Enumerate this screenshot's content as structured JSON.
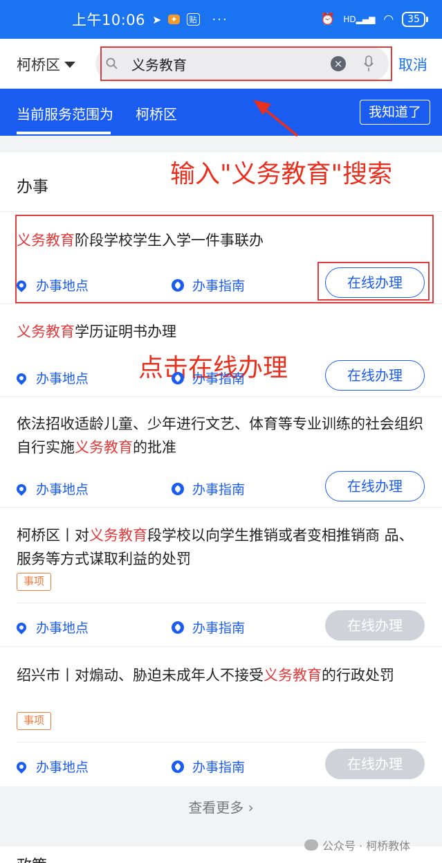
{
  "status_bar": {
    "time": "上午10:06",
    "notif_icons": [
      "navigation-icon",
      "app-icon",
      "paste-icon"
    ],
    "dots": "···",
    "network": "HD",
    "battery": "35"
  },
  "header": {
    "district": "柯桥区",
    "search_value": "义务教育",
    "cancel_label": "取消"
  },
  "notice": {
    "text": "当前服务范围为",
    "district": "柯桥区",
    "ok_label": "我知道了"
  },
  "annotations": {
    "search_hint": "输入\"义务教育\"搜索",
    "click_hint": "点击在线办理"
  },
  "section": {
    "title": "办事"
  },
  "results": [
    {
      "title_parts": [
        "义务教育",
        "阶段学校学生入学一件事联办"
      ],
      "location": "办事地点",
      "guide": "办事指南",
      "action": "在线办理",
      "enabled": true
    },
    {
      "title_parts": [
        "义务教育",
        "学历证明书办理"
      ],
      "location": "办事地点",
      "guide": "办事指南",
      "action": "在线办理",
      "enabled": true
    },
    {
      "title_parts": [
        "依法招收适龄儿童、少年进行文艺、体育等专业训练的社会组织自行实施",
        "义务教育",
        "的批准"
      ],
      "location": "办事地点",
      "guide": "办事指南",
      "action": "在线办理",
      "enabled": true
    },
    {
      "title_parts": [
        "柯桥区丨对",
        "义务教育",
        "段学校以向学生推销或者变相推销商 品、服务等方式谋取利益的处罚"
      ],
      "tag": "事项",
      "location": "办事地点",
      "guide": "办事指南",
      "action": "在线办理",
      "enabled": false
    },
    {
      "title_parts": [
        "绍兴市丨对煽动、胁迫未成年人不接受",
        "义务教育",
        "的行政处罚"
      ],
      "tag": "事项",
      "location": "办事地点",
      "guide": "办事指南",
      "action": "在线办理",
      "enabled": false
    }
  ],
  "more_label": "查看更多 ›",
  "watermark": "公众号 · 柯桥教体",
  "next_section": "政策"
}
